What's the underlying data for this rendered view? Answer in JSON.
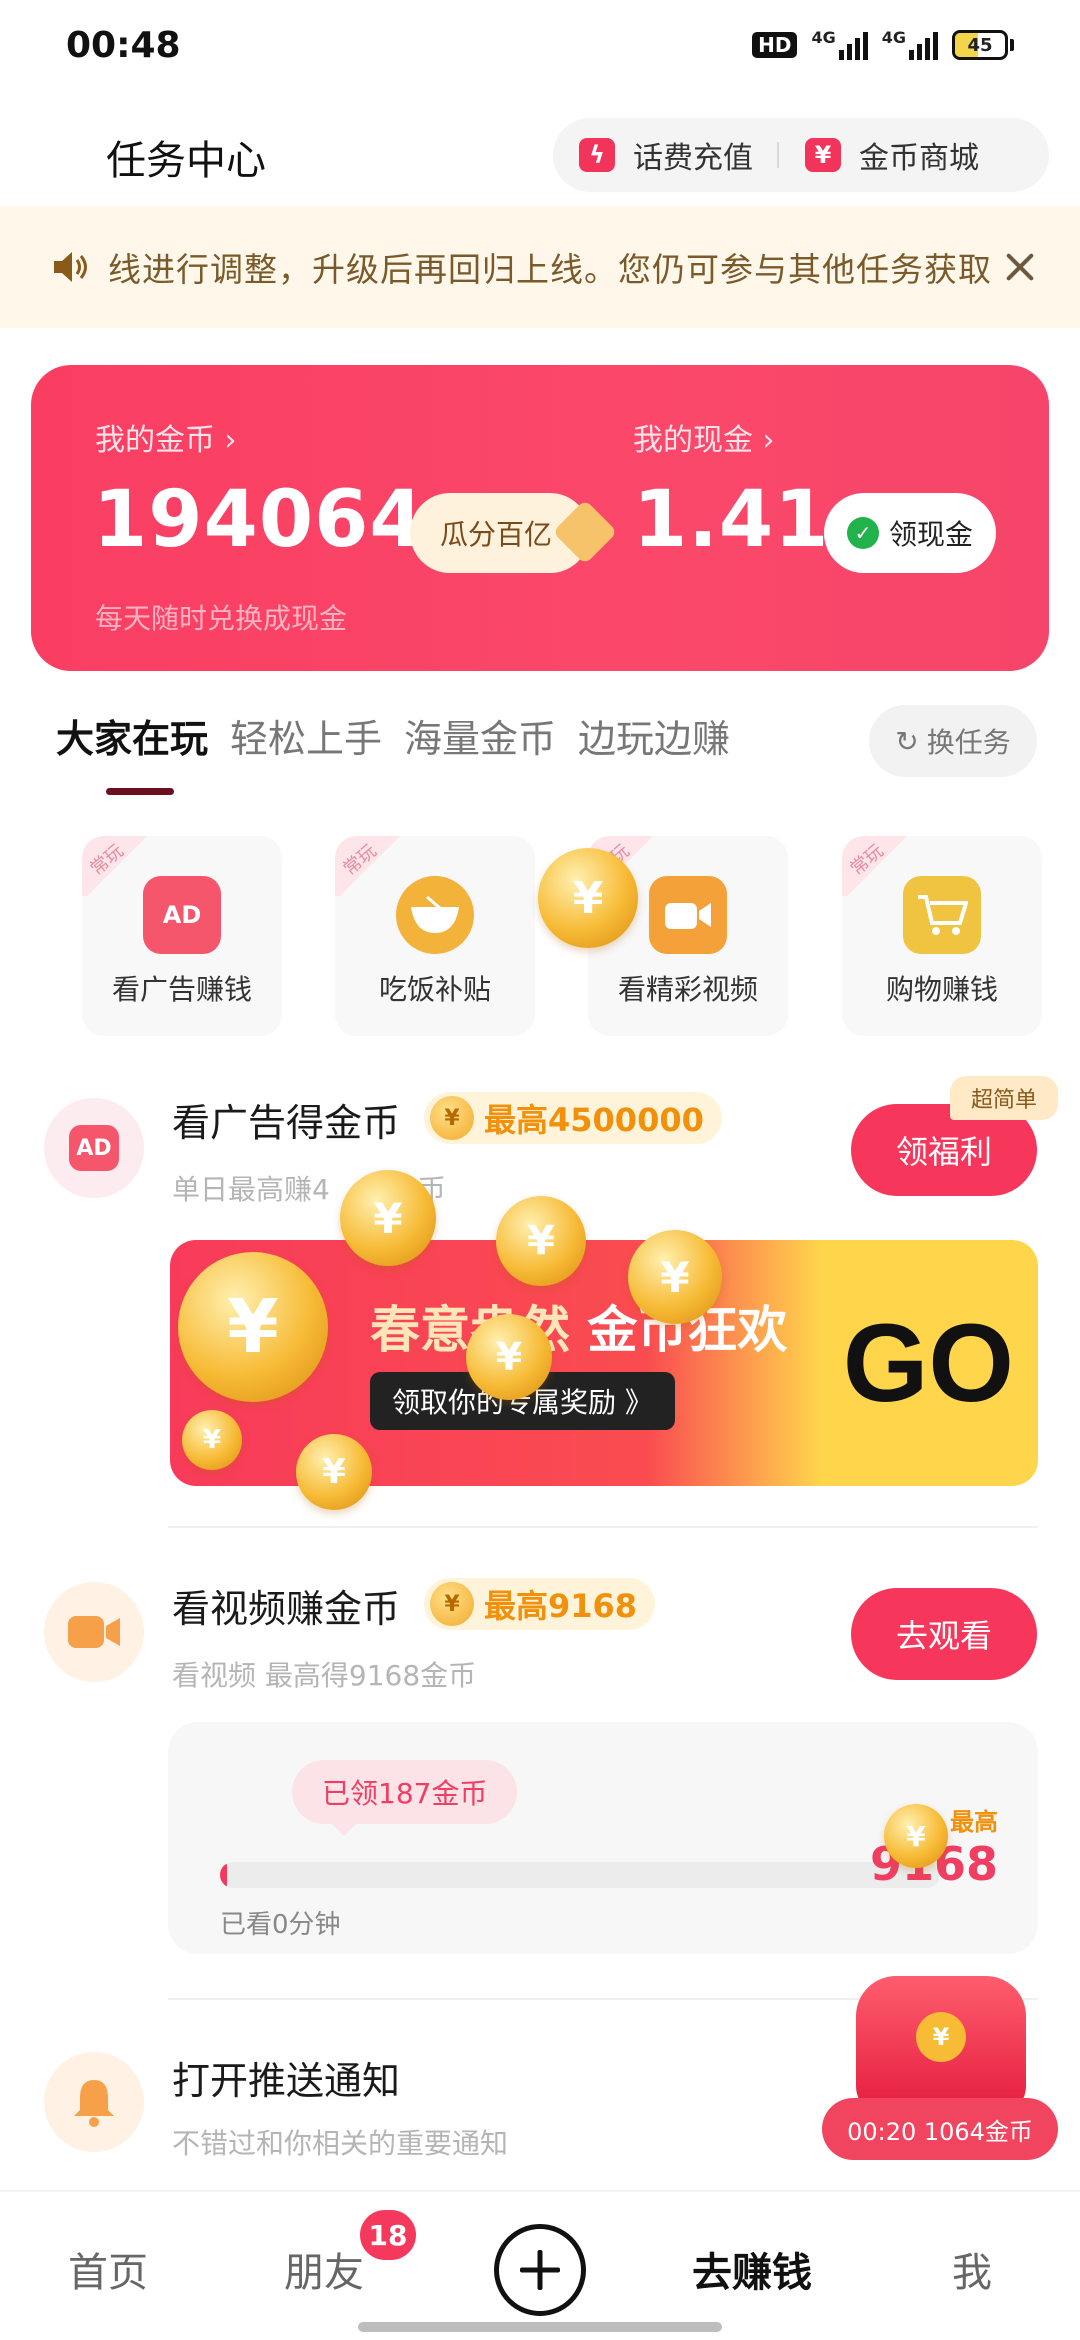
{
  "status": {
    "time": "00:48",
    "hd": "HD",
    "net1": "4G",
    "net2": "4G",
    "battery": "45",
    "battery_level": 0.45
  },
  "header": {
    "title": "任务中心",
    "recharge_label": "话费充值",
    "mall_label": "金币商城",
    "recharge_icon": "lightning-icon",
    "mall_icon": "coupon-icon"
  },
  "notice": {
    "text": "线进行调整，升级后再回归上线。您仍可参与其他任务获取",
    "icon": "speaker-icon"
  },
  "balance": {
    "coins_label": "我的金币 ›",
    "coins_value": "194064",
    "coins_sub": "每天随时兑换成现金",
    "share_button": "瓜分百亿",
    "cash_label": "我的现金 ›",
    "cash_value": "1.41",
    "withdraw_button": "领现金"
  },
  "tabs": [
    "大家在玩",
    "轻松上手",
    "海量金币",
    "边玩边赚"
  ],
  "swap_button": "换任务",
  "grid": [
    {
      "tag": "常玩",
      "name": "看广告赚钱",
      "icon": "tv-ad-icon",
      "icon_text": "AD",
      "color": "#f5566b"
    },
    {
      "tag": "常玩",
      "name": "吃饭补贴",
      "icon": "noodle-bowl-icon",
      "icon_text": "",
      "color": "#f3b23a"
    },
    {
      "tag": "常玩",
      "name": "看精彩视频",
      "icon": "video-camera-icon",
      "icon_text": "",
      "color": "#f5a13a"
    },
    {
      "tag": "常玩",
      "name": "购物赚钱",
      "icon": "shopping-cart-icon",
      "icon_text": "",
      "color": "#f0c440"
    }
  ],
  "task_ad": {
    "title": "看广告得金币",
    "max_label": "最高4500000",
    "desc": "单日最高赚4",
    "desc_tail": "金币",
    "button": "领福利",
    "badge": "超简单",
    "icon_text": "AD"
  },
  "banner": {
    "headline_a": "春意盎然",
    "headline_b": "金币狂欢",
    "sub": "领取你的专属奖励 》",
    "go": "GO"
  },
  "task_video": {
    "title": "看视频赚金币",
    "max_label": "最高9168",
    "desc": "看视频 最高得9168金币",
    "button": "去观看",
    "bubble": "已领187金币",
    "progress_label": "已看0分钟",
    "progress": 0.01,
    "max_tag": "最高",
    "max_value": "9168"
  },
  "task_push": {
    "title": "打开推送通知",
    "desc": "不错过和你相关的重要通知"
  },
  "float_reward": {
    "text": "00:20 1064金币"
  },
  "coin_symbol": "¥",
  "nav": {
    "home": "首页",
    "friends": "朋友",
    "friends_badge": "18",
    "earn": "去赚钱",
    "me": "我"
  },
  "colors": {
    "accent": "#f7365c",
    "gold": "#f0900b",
    "card": "#f93e62"
  }
}
